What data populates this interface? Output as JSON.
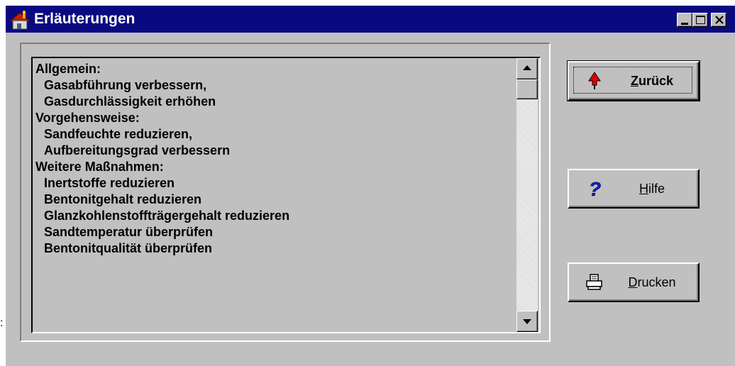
{
  "window": {
    "title": "Erläuterungen",
    "icon": "house-icon",
    "controls": [
      "minimize-icon",
      "maximize-icon",
      "close-icon"
    ],
    "title_bar_color": "#0a0a80"
  },
  "list": {
    "lines": [
      {
        "text": "Allgemein:",
        "indent": false
      },
      {
        "text": "Gasabführung verbessern,",
        "indent": true
      },
      {
        "text": "Gasdurchlässigkeit erhöhen",
        "indent": true
      },
      {
        "text": "Vorgehensweise:",
        "indent": false
      },
      {
        "text": "Sandfeuchte reduzieren,",
        "indent": true
      },
      {
        "text": "Aufbereitungsgrad verbessern",
        "indent": true
      },
      {
        "text": "Weitere Maßnahmen:",
        "indent": false
      },
      {
        "text": "Inertstoffe reduzieren",
        "indent": true
      },
      {
        "text": "Bentonitgehalt reduzieren",
        "indent": true
      },
      {
        "text": "Glanzkohlenstoffträgergehalt reduzieren",
        "indent": true
      },
      {
        "text": "Sandtemperatur überprüfen",
        "indent": true
      },
      {
        "text": "Bentonitqualität überprüfen",
        "indent": true
      }
    ],
    "scroll_position": 0
  },
  "buttons": {
    "back": {
      "mnemonic": "Z",
      "rest": "urück",
      "icon": "red-up-arrow-icon",
      "default": true
    },
    "help": {
      "mnemonic": "H",
      "rest": "ilfe",
      "icon": "question-mark-icon"
    },
    "print": {
      "mnemonic": "D",
      "rest": "rucken",
      "icon": "printer-icon"
    }
  },
  "stray_text": ":"
}
